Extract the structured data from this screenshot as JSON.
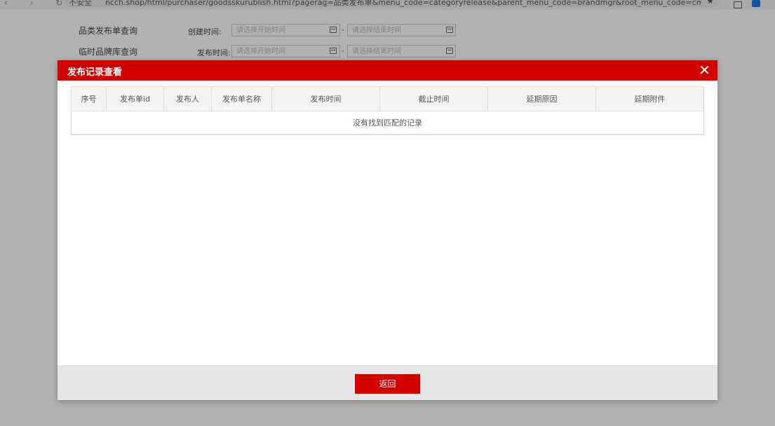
{
  "browser": {
    "security_label": "不安全",
    "url": "ncch.shop/html/purchaser/goodsskurublish.html?pagerag=品类发布单&menu_code=categoryrelease&parent_menu_code=brandmgr&root_menu_code=cma..."
  },
  "page": {
    "sidebar": [
      {
        "label": "品类发布单查询"
      },
      {
        "label": "临时品牌库查询"
      }
    ],
    "filters": [
      {
        "label": "创建时间:",
        "start_placeholder": "请选择开始时间",
        "end_placeholder": "请选择结束时间"
      },
      {
        "label": "发布时间:",
        "start_placeholder": "请选择开始时间",
        "end_placeholder": "请选择结束时间"
      }
    ],
    "range_separator": "-"
  },
  "modal": {
    "title": "发布记录查看",
    "close_glyph": "✕",
    "columns": [
      "序号",
      "发布单id",
      "发布人",
      "发布单名称",
      "发布时间",
      "截止时间",
      "延期原因",
      "延期附件"
    ],
    "empty_text": "没有找到匹配的记录",
    "back_label": "返回"
  }
}
